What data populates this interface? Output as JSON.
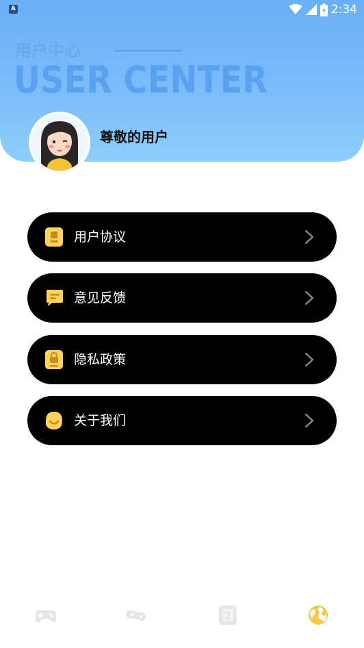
{
  "status_bar": {
    "app_badge": "A",
    "time": "2:34",
    "icons": [
      "wifi-icon",
      "signal-icon",
      "battery-icon"
    ]
  },
  "header": {
    "title_cn": "用户中心",
    "title_en": "USER CENTER",
    "username": "尊敬的用户"
  },
  "menu": [
    {
      "label": "用户协议",
      "icon": "document-icon"
    },
    {
      "label": "意见反馈",
      "icon": "chat-bubble-icon"
    },
    {
      "label": "隐私政策",
      "icon": "lock-document-icon"
    },
    {
      "label": "关于我们",
      "icon": "smiley-icon"
    }
  ],
  "bottom_nav": {
    "items": [
      {
        "icon": "gamepad-icon",
        "active": false
      },
      {
        "icon": "game-controller-icon",
        "active": false
      },
      {
        "icon": "number-card-icon",
        "text": "2",
        "active": false
      },
      {
        "icon": "globe-icon",
        "active": true
      }
    ]
  },
  "colors": {
    "header_gradient_top": "#6ab0f7",
    "header_gradient_bottom": "#8ecdfb",
    "menu_background": "#000000",
    "icon_accent": "#ffd25a",
    "nav_inactive": "#e6e6e6",
    "nav_active": "#f7c84a"
  }
}
